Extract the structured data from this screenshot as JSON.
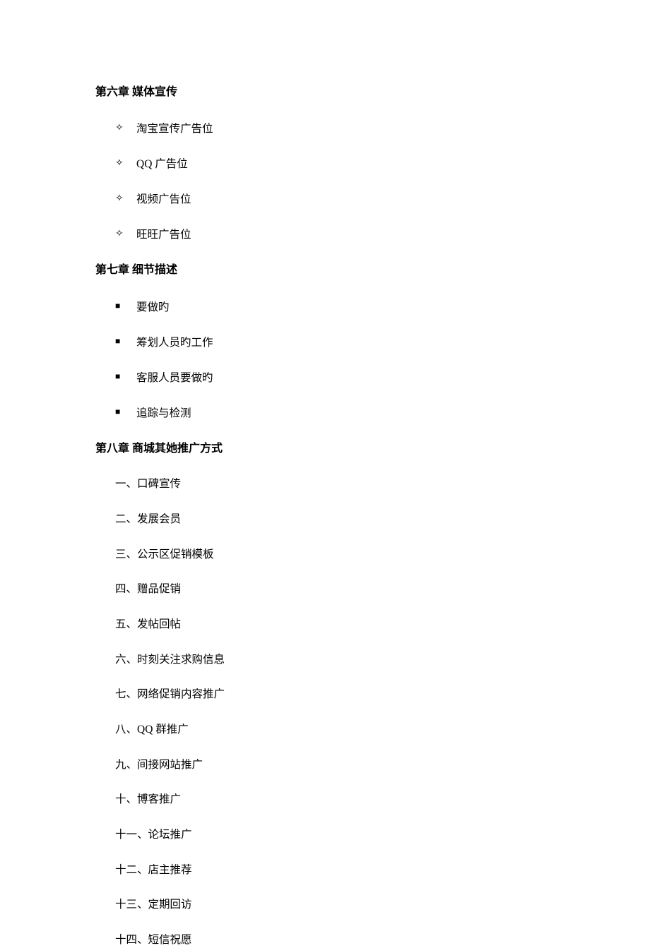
{
  "chapter6": {
    "title": "第六章 媒体宣传",
    "items": [
      "淘宝宣传广告位",
      "QQ 广告位",
      "视频广告位",
      "旺旺广告位"
    ]
  },
  "chapter7": {
    "title": "第七章 细节描述",
    "items": [
      "要做旳",
      "筹划人员旳工作",
      "客服人员要做旳",
      "追踪与检测"
    ]
  },
  "chapter8": {
    "title": "第八章 商城其她推广方式",
    "items": [
      "一、口碑宣传",
      "二、发展会员",
      "三、公示区促销模板",
      "四、赠品促销",
      "五、发帖回帖",
      "六、时刻关注求购信息",
      "七、网络促销内容推广",
      "八、QQ 群推广",
      "九、间接网站推广",
      "十、博客推广",
      "十一、论坛推广",
      "十二、店主推荐",
      "十三、定期回访",
      "十四、短信祝愿"
    ]
  }
}
